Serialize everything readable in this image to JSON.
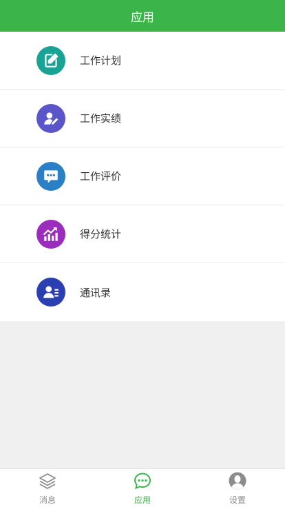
{
  "header": {
    "title": "应用"
  },
  "menu": {
    "items": [
      {
        "label": "工作计划",
        "icon": "edit-note-icon",
        "color": "#18a394"
      },
      {
        "label": "工作实绩",
        "icon": "user-pen-icon",
        "color": "#5a55c8"
      },
      {
        "label": "工作评价",
        "icon": "chat-bubble-icon",
        "color": "#2a7fc5"
      },
      {
        "label": "得分统计",
        "icon": "trend-chart-icon",
        "color": "#9b2dbd"
      },
      {
        "label": "通讯录",
        "icon": "contacts-icon",
        "color": "#2b3fb2"
      }
    ]
  },
  "tabbar": {
    "tabs": [
      {
        "label": "消息",
        "icon": "layers-icon",
        "active": false
      },
      {
        "label": "应用",
        "icon": "chat-dots-icon",
        "active": true
      },
      {
        "label": "设置",
        "icon": "user-avatar-icon",
        "active": false
      }
    ]
  },
  "colors": {
    "accent": "#3bb54a",
    "background": "#f0f0f0",
    "inactive_tab": "#8c8c8c"
  }
}
